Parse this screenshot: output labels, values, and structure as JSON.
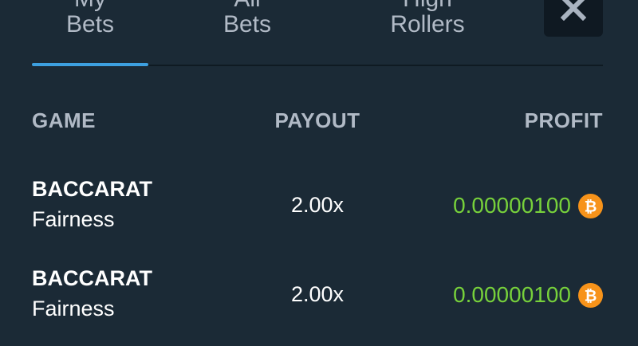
{
  "tabs": [
    {
      "line1": "My",
      "line2": "Bets",
      "active": true
    },
    {
      "line1": "All",
      "line2": "Bets",
      "active": false
    },
    {
      "line1": "High",
      "line2": "Rollers",
      "active": false
    }
  ],
  "close_icon": "close-x-icon",
  "columns": {
    "game": "GAME",
    "payout": "PAYOUT",
    "profit": "PROFIT"
  },
  "rows": [
    {
      "game": "BACCARAT",
      "sub": "Fairness",
      "payout": "2.00x",
      "profit": "0.00000100",
      "currency_icon": "bitcoin-icon"
    },
    {
      "game": "BACCARAT",
      "sub": "Fairness",
      "payout": "2.00x",
      "profit": "0.00000100",
      "currency_icon": "bitcoin-icon"
    }
  ],
  "colors": {
    "background": "#1b2a36",
    "tab_text": "#b1bac6",
    "active_indicator": "#3da0e0",
    "profit_text": "#77d13b",
    "bitcoin": "#f7931a"
  }
}
